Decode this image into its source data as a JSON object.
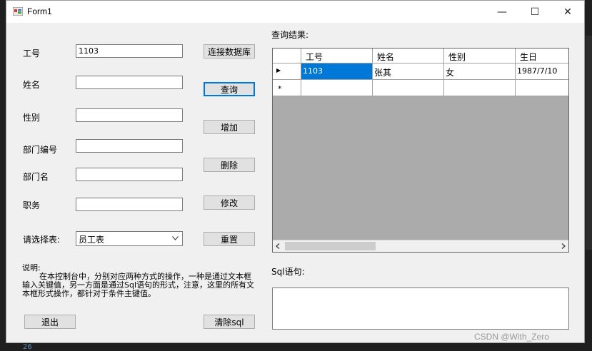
{
  "window": {
    "title": "Form1",
    "minimize_glyph": "—",
    "maximize_glyph": "☐",
    "close_glyph": "✕",
    "icon": "form-icon"
  },
  "form": {
    "emp_id_label": "工号",
    "emp_id_value": "1103",
    "name_label": "姓名",
    "gender_label": "性别",
    "dept_no_label": "部门编号",
    "dept_name_label": "部门名",
    "position_label": "职务",
    "select_table_label": "请选择表:",
    "select_table_value": "员工表"
  },
  "buttons": {
    "connect": "连接数据库",
    "query": "查询",
    "add": "增加",
    "delete": "删除",
    "modify": "修改",
    "reset": "重置",
    "exit": "退出",
    "clear_sql": "清除sql"
  },
  "description": {
    "title": "说明:",
    "body": "在本控制台中，分别对应两种方式的操作，一种是通过文本框输入关键值，另一方面是通过Sql语句的形式，注意，这里的所有文本框形式操作，都针对于条件主键值。"
  },
  "results": {
    "label": "查询结果:",
    "columns": [
      "工号",
      "姓名",
      "性别",
      "生日"
    ],
    "rows": [
      [
        "1103",
        "张其",
        "女",
        "1987/7/10"
      ]
    ],
    "current_row_marker": "▶",
    "new_row_marker": "*"
  },
  "sql": {
    "label": "Sql语句:",
    "value": ""
  },
  "watermark": "CSDN @With_Zero",
  "background_fragment": "26",
  "colors": {
    "selection": "#0078d7",
    "grid_bg": "#ababab",
    "focus_border": "#0078d7"
  }
}
